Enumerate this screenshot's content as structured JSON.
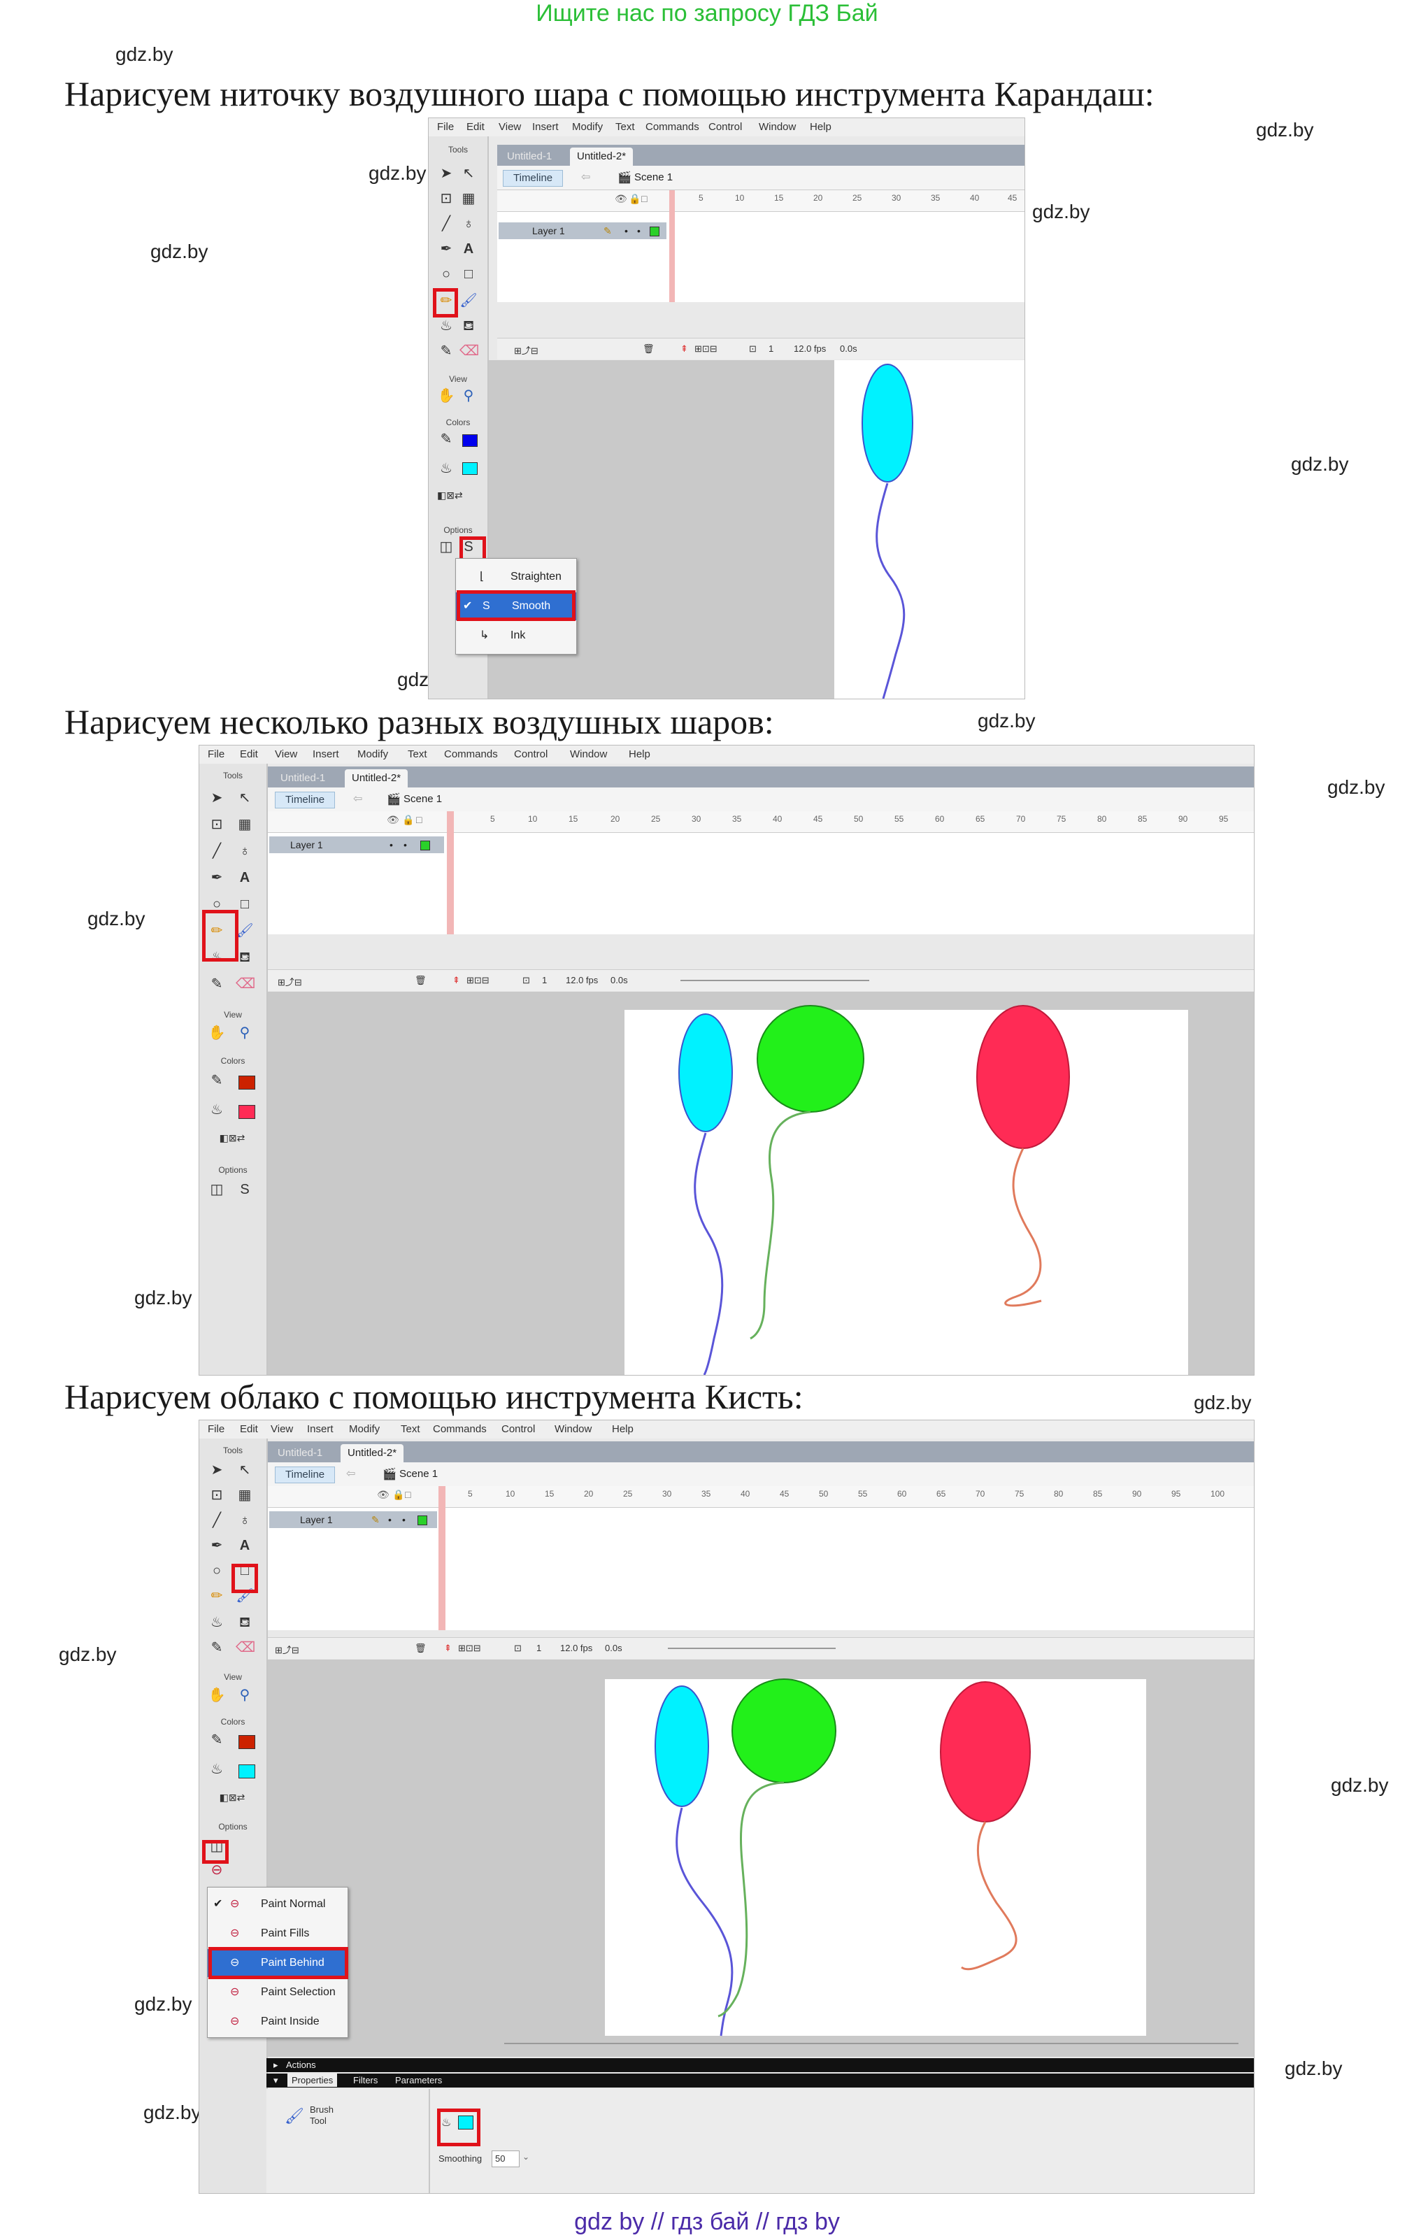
{
  "top_link": "Ищите нас по запросу ГДЗ Бай",
  "bottom_link": "gdz by  //  гдз бай  //  гдз by",
  "watermark": "gdz.by",
  "headings": {
    "h1": "Нарисуем ниточку воздушного шара с помощью инструмента Карандаш:",
    "h2": "Нарисуем несколько разных воздушных шаров:",
    "h3": "Нарисуем облако с помощью инструмента Кисть:"
  },
  "flash": {
    "menu": [
      "File",
      "Edit",
      "View",
      "Insert",
      "Modify",
      "Text",
      "Commands",
      "Control",
      "Window",
      "Help"
    ],
    "tabs": [
      "Untitled-1",
      "Untitled-2*"
    ],
    "timeline_button": "Timeline",
    "scene": "Scene 1",
    "layer": "Layer 1",
    "tools_label": "Tools",
    "view_label": "View",
    "colors_label": "Colors",
    "options_label": "Options",
    "frame": "1",
    "fps": "12.0 fps",
    "time": "0.0s",
    "ruler_short": [
      "5",
      "10",
      "15",
      "20",
      "25",
      "30",
      "35",
      "40",
      "45"
    ],
    "ruler_long": [
      "5",
      "10",
      "15",
      "20",
      "25",
      "30",
      "35",
      "40",
      "45",
      "50",
      "55",
      "60",
      "65",
      "70",
      "75",
      "80",
      "85",
      "90",
      "95"
    ],
    "ruler_long3": [
      "5",
      "10",
      "15",
      "20",
      "25",
      "30",
      "35",
      "40",
      "45",
      "50",
      "55",
      "60",
      "65",
      "70",
      "75",
      "80",
      "85",
      "90",
      "95",
      "100"
    ]
  },
  "smooth_menu": [
    "Straighten",
    "Smooth",
    "Ink"
  ],
  "paint_menu": [
    "Paint Normal",
    "Paint Fills",
    "Paint Behind",
    "Paint Selection",
    "Paint Inside"
  ],
  "panels": {
    "actions": "Actions",
    "properties_tabs": [
      "Properties",
      "Filters",
      "Parameters"
    ],
    "brush_tool": "Brush",
    "brush_tool2": "Tool",
    "smoothing_label": "Smoothing",
    "smoothing_value": "50"
  },
  "colors": {
    "cyan": "#00f2ff",
    "green": "#22f01a",
    "red": "#ff2b55",
    "stroke_blue": "#5a55d8",
    "stroke_green": "#66b15c",
    "stroke_red": "#e07a5c",
    "highlight": "#e0121a"
  }
}
